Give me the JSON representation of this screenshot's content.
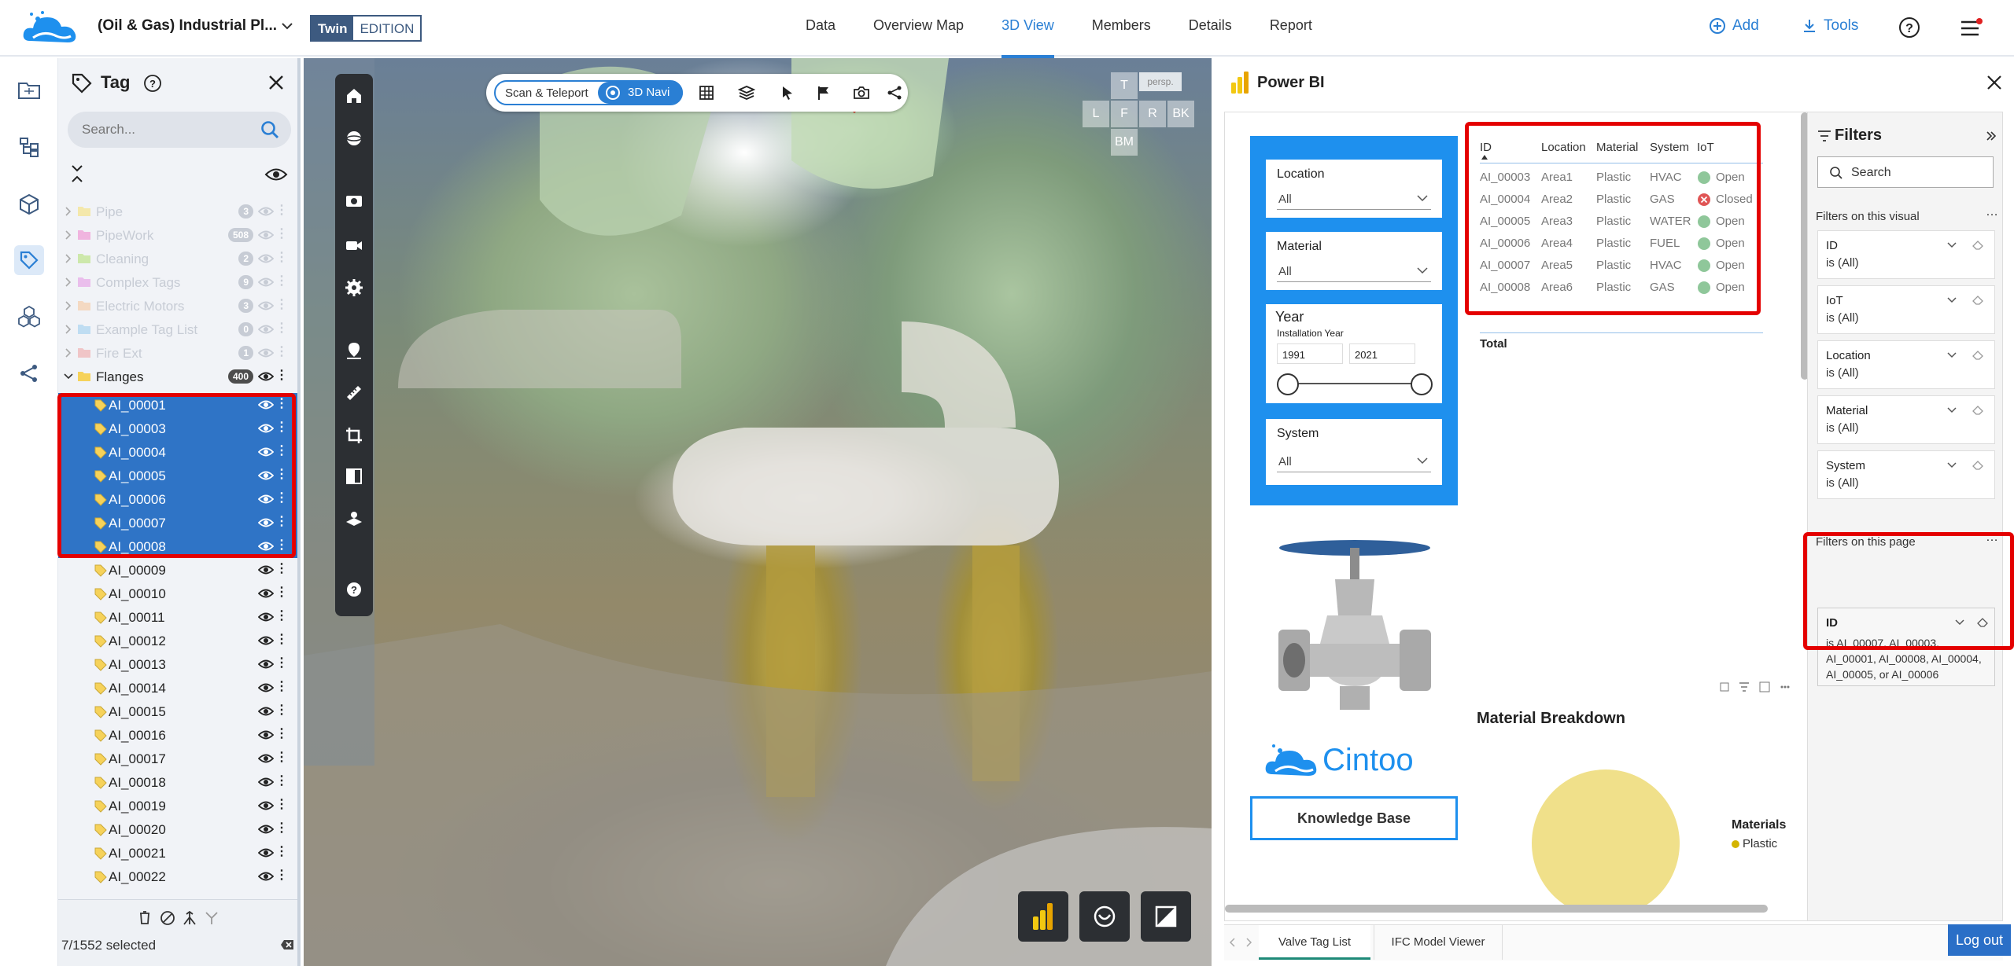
{
  "header": {
    "project_title": "(Oil & Gas) Industrial Pl...",
    "edition_badge_a": "Twin",
    "edition_badge_b": "EDITION",
    "tabs": [
      {
        "label": "Data"
      },
      {
        "label": "Overview Map"
      },
      {
        "label": "3D View"
      },
      {
        "label": "Members"
      },
      {
        "label": "Details"
      },
      {
        "label": "Report"
      }
    ],
    "active_tab": "3D View",
    "add_label": "Add",
    "tools_label": "Tools",
    "accent": "#2a7fd4"
  },
  "tag_panel": {
    "title": "Tag",
    "search_placeholder": "Search...",
    "groups": [
      {
        "label": "Pipe",
        "count": "3",
        "color": "#f6e27a"
      },
      {
        "label": "PipeWork",
        "count": "508",
        "color": "#f08bd0"
      },
      {
        "label": "Cleaning",
        "count": "2",
        "color": "#b6e27a"
      },
      {
        "label": "Complex Tags",
        "count": "9",
        "color": "#e79be6"
      },
      {
        "label": "Electric Motors",
        "count": "3",
        "color": "#f7c9a0"
      },
      {
        "label": "Example Tag List",
        "count": "0",
        "color": "#9fd0f0"
      },
      {
        "label": "Fire Ext",
        "count": "1",
        "color": "#f0a8a8"
      },
      {
        "label": "Flanges",
        "count": "400",
        "color": "#f6d25a"
      }
    ],
    "items": [
      {
        "label": "AI_00001",
        "selected": true
      },
      {
        "label": "AI_00003",
        "selected": true
      },
      {
        "label": "AI_00004",
        "selected": true
      },
      {
        "label": "AI_00005",
        "selected": true
      },
      {
        "label": "AI_00006",
        "selected": true
      },
      {
        "label": "AI_00007",
        "selected": true
      },
      {
        "label": "AI_00008",
        "selected": true
      },
      {
        "label": "AI_00009",
        "selected": false
      },
      {
        "label": "AI_00010",
        "selected": false
      },
      {
        "label": "AI_00011",
        "selected": false
      },
      {
        "label": "AI_00012",
        "selected": false
      },
      {
        "label": "AI_00013",
        "selected": false
      },
      {
        "label": "AI_00014",
        "selected": false
      },
      {
        "label": "AI_00015",
        "selected": false
      },
      {
        "label": "AI_00016",
        "selected": false
      },
      {
        "label": "AI_00017",
        "selected": false
      },
      {
        "label": "AI_00018",
        "selected": false
      },
      {
        "label": "AI_00019",
        "selected": false
      },
      {
        "label": "AI_00020",
        "selected": false
      },
      {
        "label": "AI_00021",
        "selected": false
      },
      {
        "label": "AI_00022",
        "selected": false
      }
    ],
    "selection_status": "7/1552 selected"
  },
  "viewer": {
    "scan_teleport_label": "Scan & Teleport",
    "navi_label": "3D Navi",
    "view_cube": {
      "top": "T",
      "persp": "persp.",
      "left": "L",
      "front": "F",
      "right": "R",
      "back": "BK",
      "bottom": "BM"
    }
  },
  "powerbi": {
    "title": "Power BI",
    "slicers": {
      "location_label": "Location",
      "location_value": "All",
      "material_label": "Material",
      "material_value": "All",
      "year_label": "Year",
      "year_sub": "Installation Year",
      "year_from": "1991",
      "year_to": "2021",
      "system_label": "System",
      "system_value": "All"
    },
    "table": {
      "headers": [
        "ID",
        "Location",
        "Material",
        "System",
        "IoT"
      ],
      "rows": [
        {
          "id": "AI_00003",
          "location": "Area1",
          "material": "Plastic",
          "system": "HVAC",
          "iot": "Open"
        },
        {
          "id": "AI_00004",
          "location": "Area2",
          "material": "Plastic",
          "system": "GAS",
          "iot": "Closed"
        },
        {
          "id": "AI_00005",
          "location": "Area3",
          "material": "Plastic",
          "system": "WATER",
          "iot": "Open"
        },
        {
          "id": "AI_00006",
          "location": "Area4",
          "material": "Plastic",
          "system": "FUEL",
          "iot": "Open"
        },
        {
          "id": "AI_00007",
          "location": "Area5",
          "material": "Plastic",
          "system": "HVAC",
          "iot": "Open"
        },
        {
          "id": "AI_00008",
          "location": "Area6",
          "material": "Plastic",
          "system": "GAS",
          "iot": "Open"
        }
      ],
      "total_label": "Total",
      "open_color": "#8fc79a",
      "closed_color": "#e05555"
    },
    "brand_name": "Cintoo",
    "knowledge_base_label": "Knowledge Base",
    "material_breakdown_title": "Material Breakdown",
    "legend_title": "Materials",
    "legend_item": "Plastic",
    "pie_color": "#f0e08a",
    "filters": {
      "title": "Filters",
      "search_placeholder": "Search",
      "section_visual": "Filters on this visual",
      "visual_filters": [
        {
          "name": "ID",
          "value": "is (All)"
        },
        {
          "name": "IoT",
          "value": "is (All)"
        },
        {
          "name": "Location",
          "value": "is (All)"
        },
        {
          "name": "Material",
          "value": "is (All)"
        },
        {
          "name": "System",
          "value": "is (All)"
        }
      ],
      "section_page": "Filters on this page",
      "page_filter_name": "ID",
      "page_filter_value": "is AI_00007, AI_00003, AI_00001, AI_00008, AI_00004, AI_00005, or AI_00006"
    },
    "tabs": [
      {
        "label": "Valve Tag List",
        "active": true
      },
      {
        "label": "IFC Model Viewer",
        "active": false
      }
    ],
    "logout_label": "Log out"
  }
}
